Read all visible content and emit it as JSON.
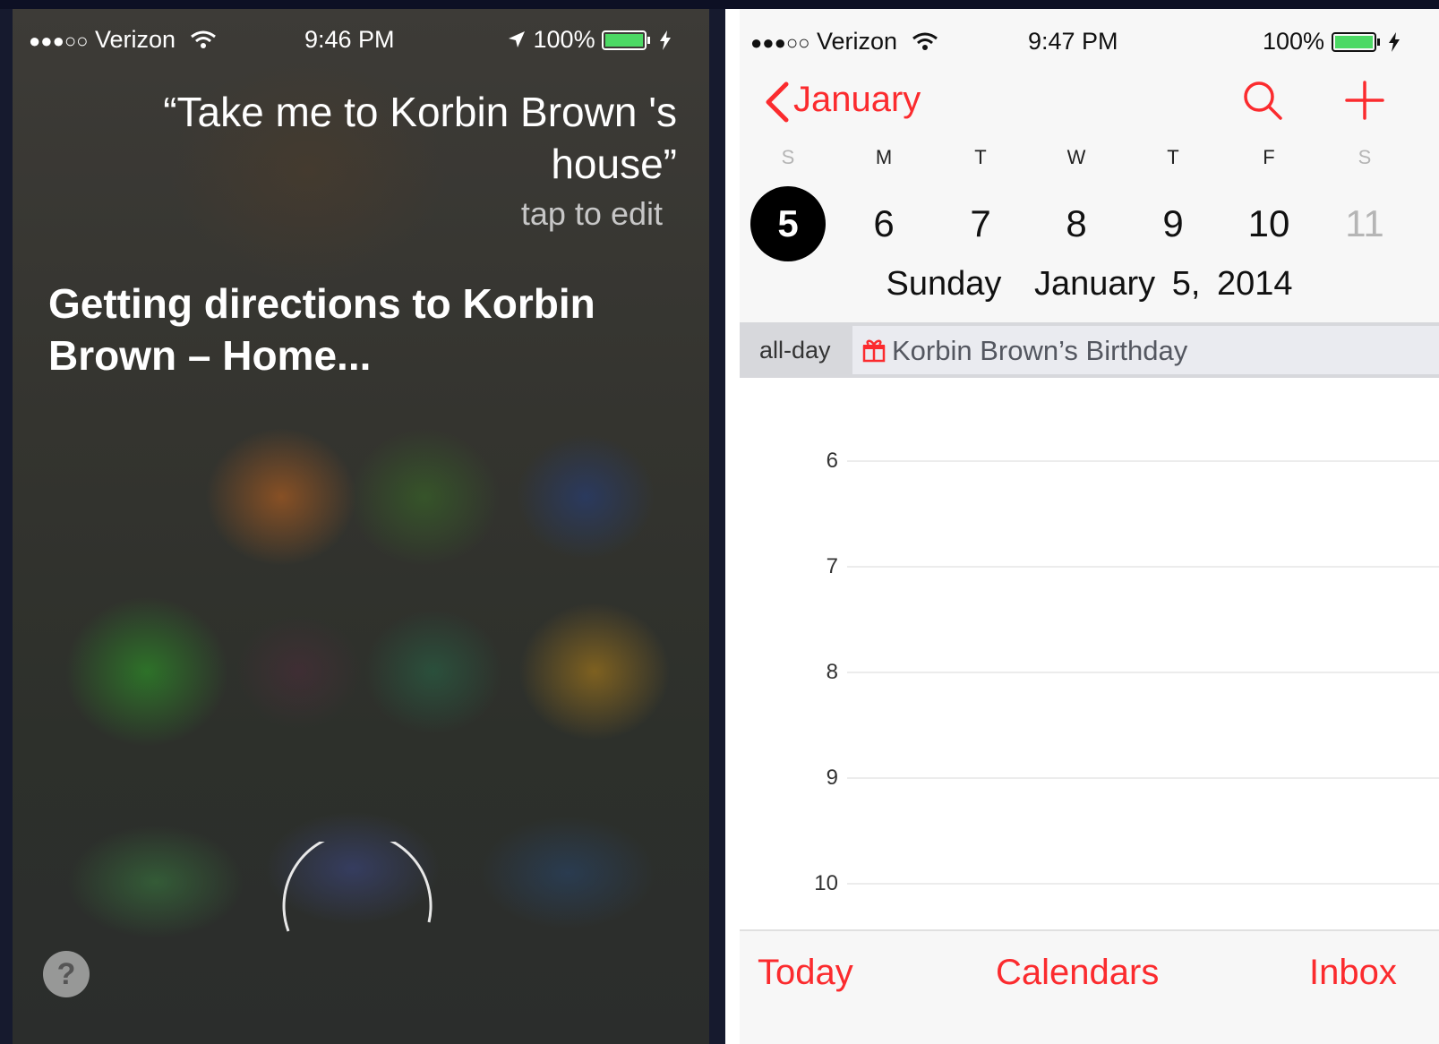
{
  "siri": {
    "status_bar": {
      "signal": "●●●○○",
      "carrier": "Verizon",
      "time": "9:46 PM",
      "battery": "100%"
    },
    "user_query": "“Take me to Korbin Brown 's house”",
    "tap_to_edit": "tap to edit",
    "response": "Getting directions to Korbin Brown – Home...",
    "help_label": "?"
  },
  "calendar": {
    "status_bar": {
      "signal": "●●●○○",
      "carrier": "Verizon",
      "time": "9:47 PM",
      "battery": "100%"
    },
    "back_label": "January",
    "weekdays": [
      "S",
      "M",
      "T",
      "W",
      "T",
      "F",
      "S"
    ],
    "days": [
      "5",
      "6",
      "7",
      "8",
      "9",
      "10",
      "11"
    ],
    "selected_weekday": "Sunday",
    "selected_date": "January 5, 2014",
    "all_day_label": "all-day",
    "all_day_event": "Korbin Brown’s Birthday",
    "hours": [
      "6",
      "7",
      "8",
      "9",
      "10"
    ],
    "tabs": {
      "today": "Today",
      "calendars": "Calendars",
      "inbox": "Inbox"
    },
    "colors": {
      "accent": "#fb2b2e",
      "selected_day_bg": "#000000",
      "battery": "#4cd964"
    }
  }
}
